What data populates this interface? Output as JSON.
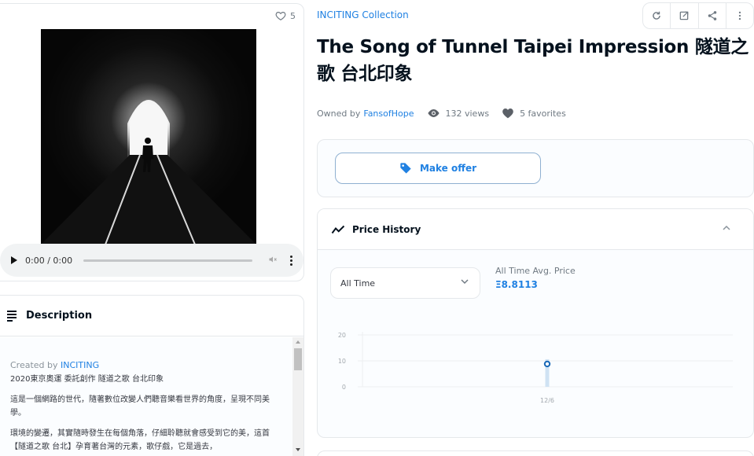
{
  "media": {
    "favorites_count": "5",
    "artwork_alt": "Silhouette walking through a dark railway tunnel toward light",
    "audio": {
      "time": "0:00 / 0:00",
      "progress": 0
    }
  },
  "description": {
    "title": "Description",
    "created_by_label": "Created by",
    "creator": "INCITING",
    "paragraphs": [
      "2020東京奧運 委託創作 隧道之歌 台北印象",
      "這是一個網路的世代，隨著數位改變人們聽音樂看世界的角度，呈現不同美學。",
      "環境的變遷，其實隨時發生在每個角落，仔細聆聽就會感受到它的美，這首【隧道之歌 台北】孕育著台灣的元素，歌仔戲，它是過去，"
    ]
  },
  "header": {
    "collection": "INCITING Collection",
    "actions": [
      {
        "name": "refresh",
        "icon": "refresh-icon"
      },
      {
        "name": "open-external",
        "icon": "external-link-icon"
      },
      {
        "name": "share",
        "icon": "share-icon"
      },
      {
        "name": "more",
        "icon": "more-vertical-icon"
      }
    ],
    "title": "The Song of Tunnel Taipei Impression 隧道之歌 台北印象"
  },
  "meta": {
    "owned_by_label": "Owned by",
    "owner": "FansofHope",
    "views": "132 views",
    "favorites": "5 favorites"
  },
  "offer": {
    "button_label": "Make offer"
  },
  "price_history": {
    "title": "Price History",
    "period_selected": "All Time",
    "avg_label": "All Time Avg. Price",
    "avg_value": "Ξ8.8113"
  },
  "colors": {
    "accent": "#2081e2",
    "text_primary": "#04111d",
    "text_secondary": "#707a83",
    "border": "#e5e8eb"
  },
  "chart_data": {
    "type": "scatter",
    "title": "",
    "xlabel": "",
    "ylabel": "",
    "categories": [
      "12/6"
    ],
    "series": [
      {
        "name": "Avg. Price",
        "values": [
          8.8113
        ]
      }
    ],
    "y_ticks": [
      "0",
      "10",
      "20"
    ],
    "ylim": [
      0,
      20
    ],
    "grid": true,
    "legend": "none"
  }
}
